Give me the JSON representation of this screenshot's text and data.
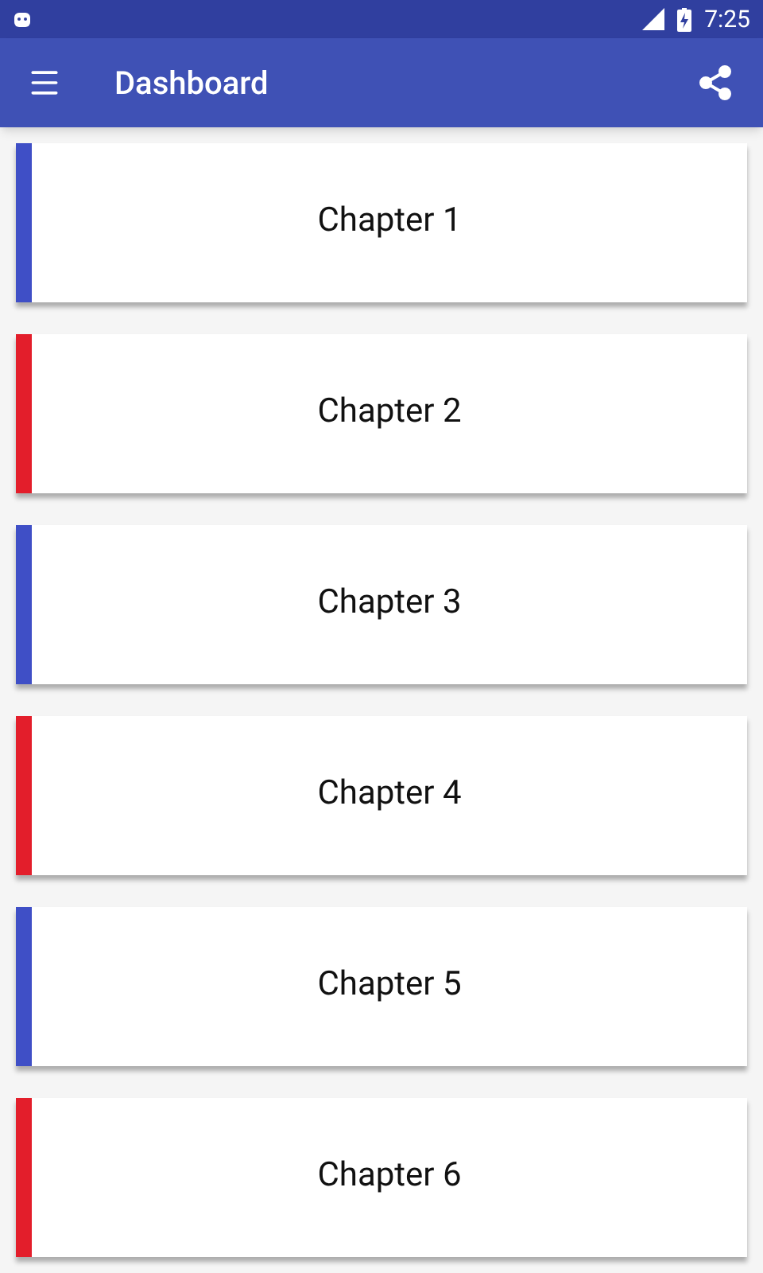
{
  "status_bar": {
    "time": "7:25"
  },
  "toolbar": {
    "title": "Dashboard"
  },
  "chapters": [
    {
      "label": "Chapter 1",
      "color": "#3f4fc6"
    },
    {
      "label": "Chapter 2",
      "color": "#e31e2b"
    },
    {
      "label": "Chapter 3",
      "color": "#3f4fc6"
    },
    {
      "label": "Chapter 4",
      "color": "#e31e2b"
    },
    {
      "label": "Chapter 5",
      "color": "#3f4fc6"
    },
    {
      "label": "Chapter 6",
      "color": "#e31e2b"
    }
  ]
}
